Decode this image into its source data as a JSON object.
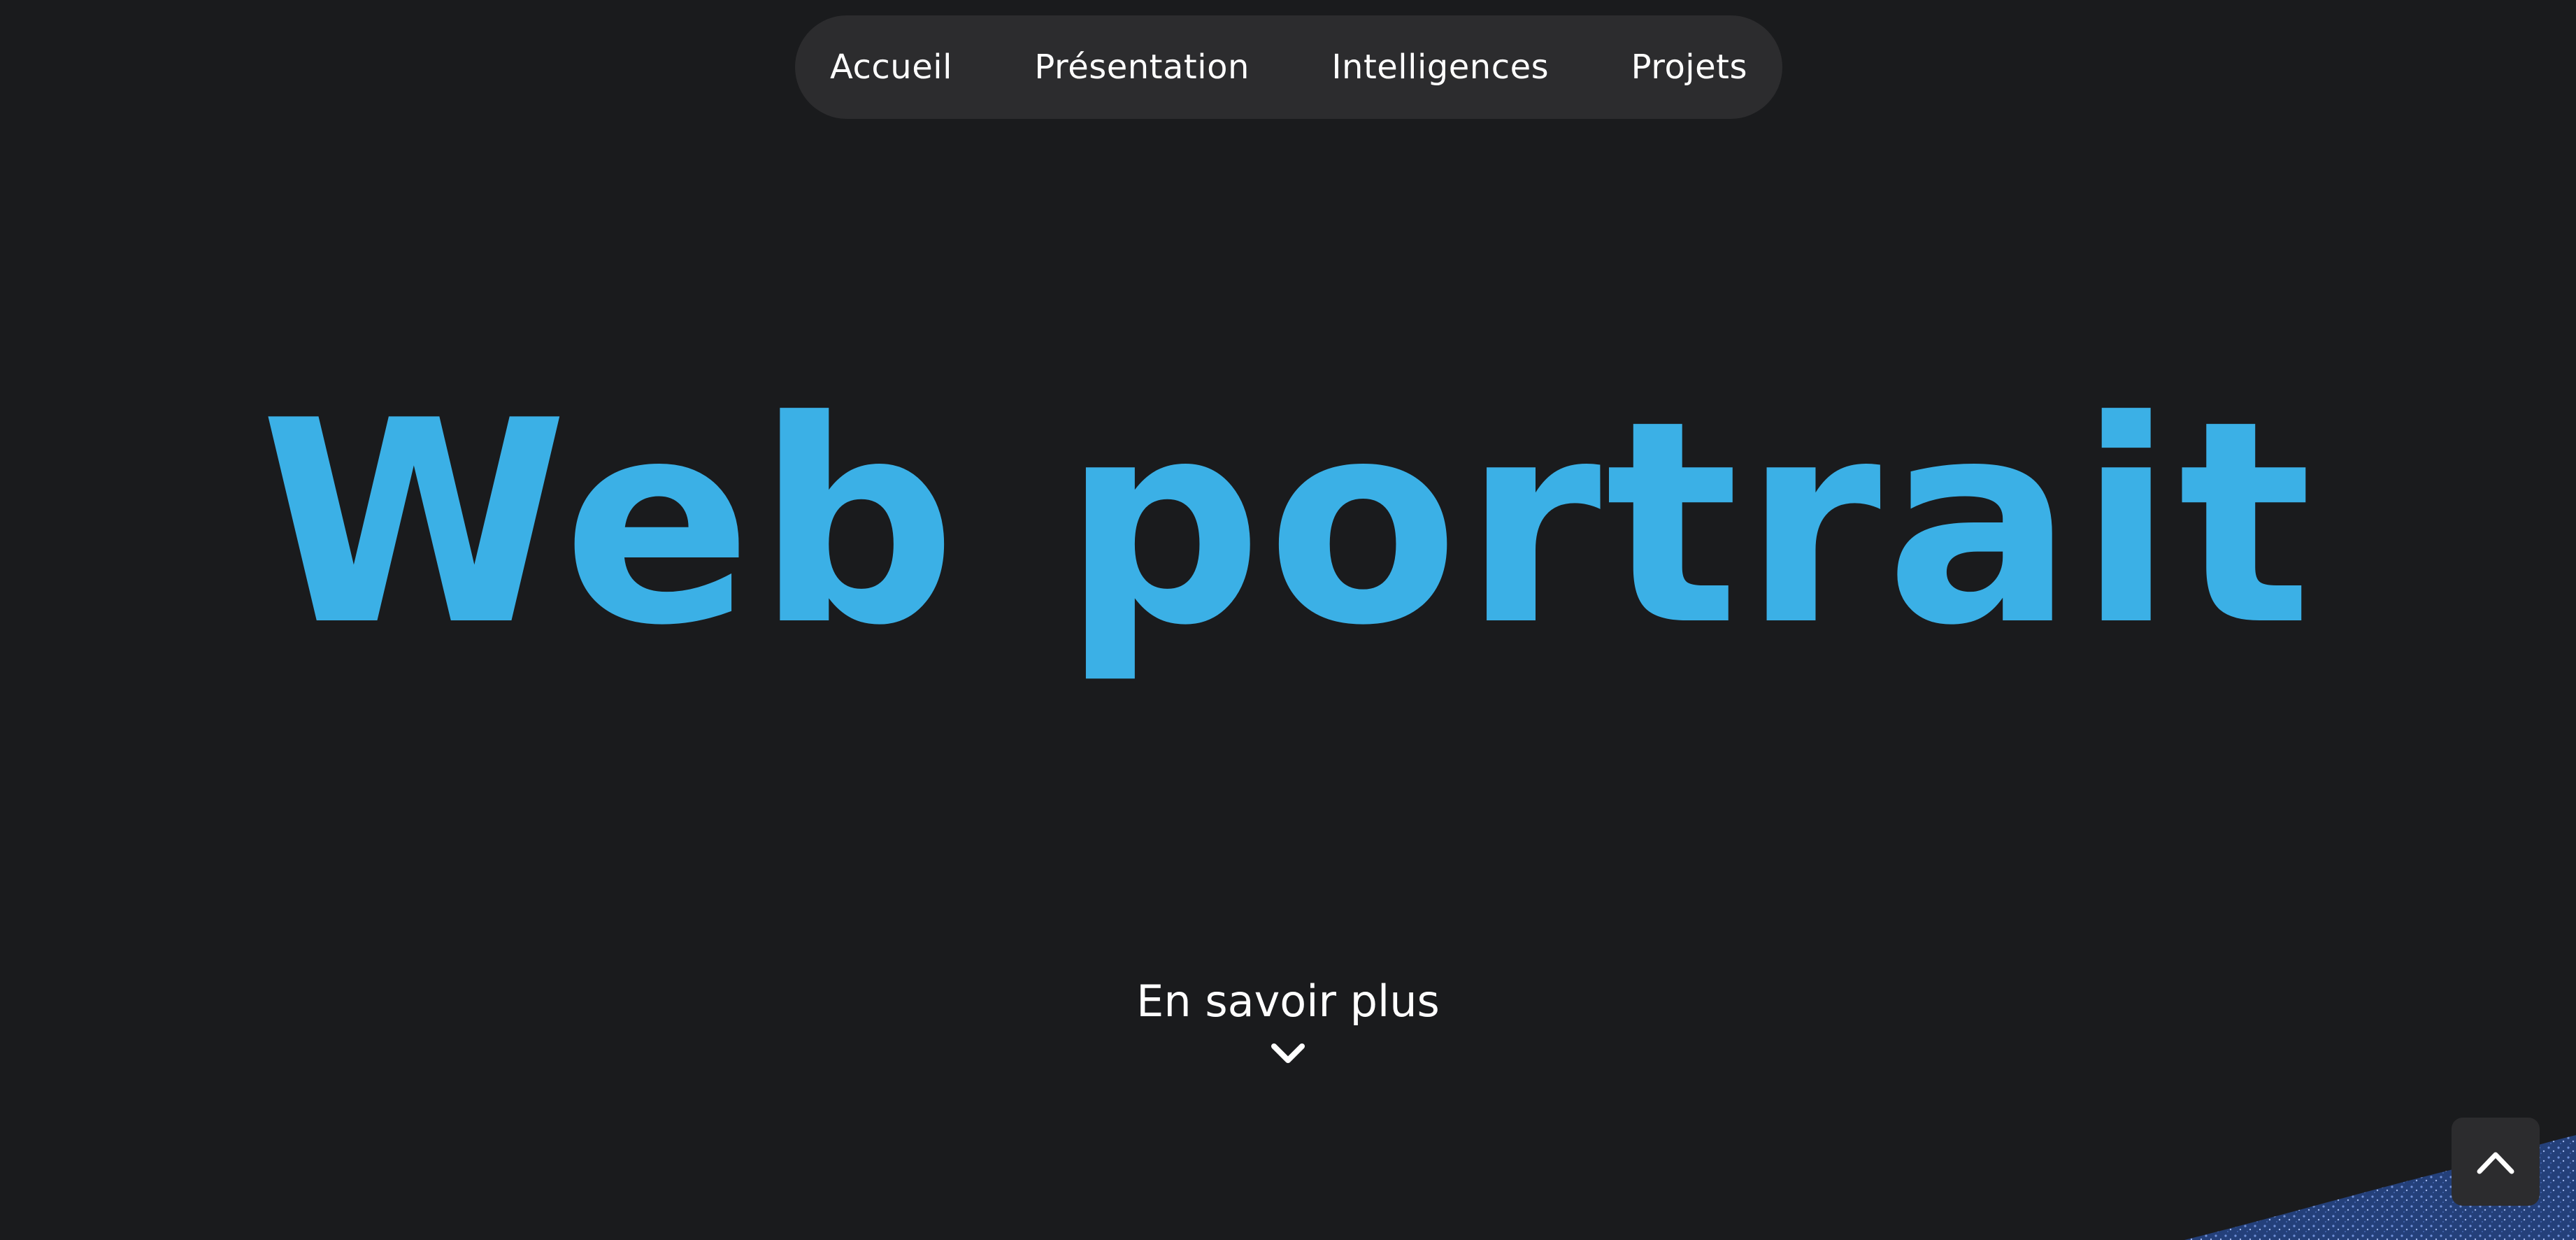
{
  "nav": {
    "items": [
      {
        "label": "Accueil"
      },
      {
        "label": "Présentation"
      },
      {
        "label": "Intelligences"
      },
      {
        "label": "Projets"
      }
    ]
  },
  "hero": {
    "title": "Web portrait"
  },
  "cta": {
    "label": "En savoir plus",
    "icon": "chevron-down-icon"
  },
  "back_to_top": {
    "icon": "chevron-up-icon"
  },
  "colors": {
    "background": "#1a1b1d",
    "nav_background": "#2c2c2e",
    "accent": "#3bb0e6",
    "text": "#ffffff",
    "glitter": "#2a4a8c"
  }
}
